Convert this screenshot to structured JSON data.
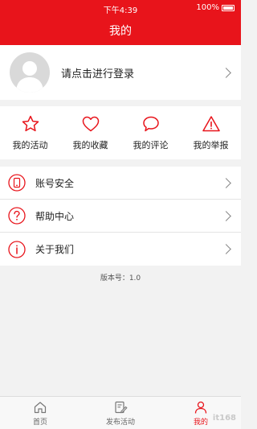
{
  "status_bar": {
    "time": "下午4:39",
    "battery": "100%"
  },
  "header": {
    "title": "我的"
  },
  "profile": {
    "login_prompt": "请点击进行登录"
  },
  "quick_actions": [
    {
      "label": "我的活动",
      "icon": "star-icon"
    },
    {
      "label": "我的收藏",
      "icon": "heart-icon"
    },
    {
      "label": "我的评论",
      "icon": "comment-bubble-icon"
    },
    {
      "label": "我的举报",
      "icon": "warning-triangle-icon"
    }
  ],
  "menu": [
    {
      "label": "账号安全",
      "icon": "phone-icon"
    },
    {
      "label": "帮助中心",
      "icon": "question-icon"
    },
    {
      "label": "关于我们",
      "icon": "info-icon"
    }
  ],
  "version": "版本号：1.0",
  "tab_bar": [
    {
      "label": "首页",
      "icon": "home-icon"
    },
    {
      "label": "发布活动",
      "icon": "edit-icon"
    },
    {
      "label": "我的",
      "icon": "user-icon"
    }
  ],
  "watermark": "it168",
  "colors": {
    "primary": "#e8141b",
    "background": "#f2f2f2"
  }
}
